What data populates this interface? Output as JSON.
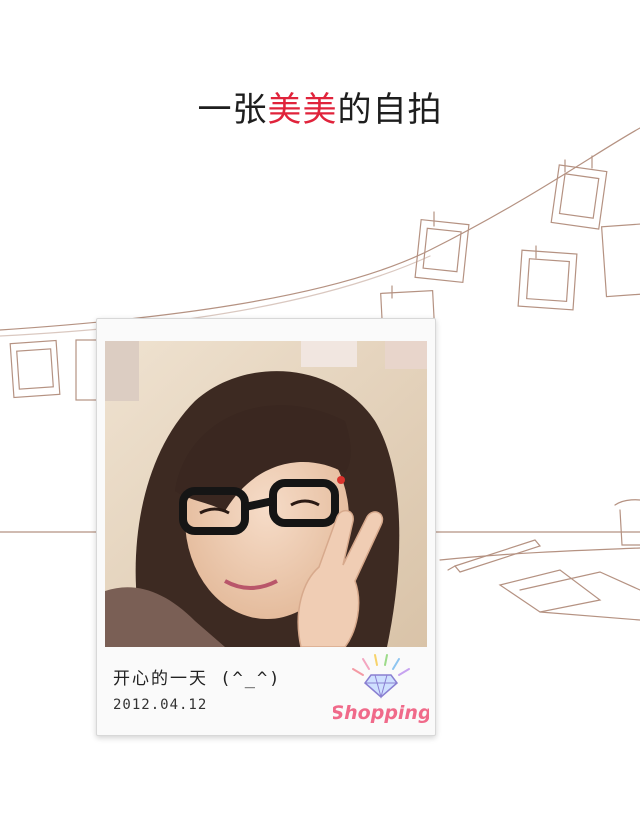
{
  "headline": {
    "prefix": "一张",
    "accent": "美美",
    "suffix": "的自拍"
  },
  "polaroid": {
    "caption": "开心的一天 (^_^)",
    "date": "2012.04.12",
    "logo_text": "Shopping"
  },
  "colors": {
    "accent": "#e0233b",
    "sketch_line": "#b08a7a",
    "logo_pink": "#f06a8a"
  }
}
